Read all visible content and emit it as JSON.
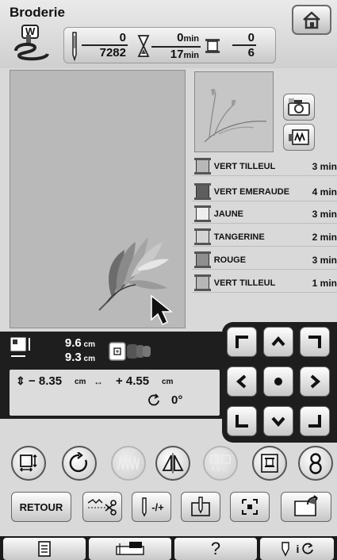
{
  "header": {
    "title": "Broderie",
    "presser_foot_letter": "W",
    "stitch_count": {
      "current": "0",
      "total": "7282"
    },
    "time": {
      "current": "0",
      "total": "17",
      "unit": "min"
    },
    "color_changes": {
      "current": "0",
      "total": "6"
    }
  },
  "threads": [
    {
      "name": "VERT TILLEUL",
      "time": "3 min",
      "color": "#b7b7b7"
    },
    {
      "name": "VERT EMERAUDE",
      "time": "4 min",
      "color": "#5e5e5e"
    },
    {
      "name": "JAUNE",
      "time": "3 min",
      "color": "#eeeeee"
    },
    {
      "name": "TANGERINE",
      "time": "2 min",
      "color": "#d4d4d4"
    },
    {
      "name": "ROUGE",
      "time": "3 min",
      "color": "#8e8e8e"
    },
    {
      "name": "VERT TILLEUL",
      "time": "1 min",
      "color": "#b7b7b7"
    }
  ],
  "size": {
    "height": "9.6",
    "width": "9.3",
    "unit": "cm"
  },
  "position": {
    "vertical": "− 8.35",
    "horizontal": "+ 4.55",
    "unit": "cm"
  },
  "rotation": {
    "angle": "0°"
  },
  "buttons": {
    "back": "RETOUR",
    "needle_pm": "-/+",
    "help": "?"
  },
  "icons": {
    "home": "house-icon",
    "camera": "camera-icon",
    "zoom": "thread-preview-icon"
  }
}
